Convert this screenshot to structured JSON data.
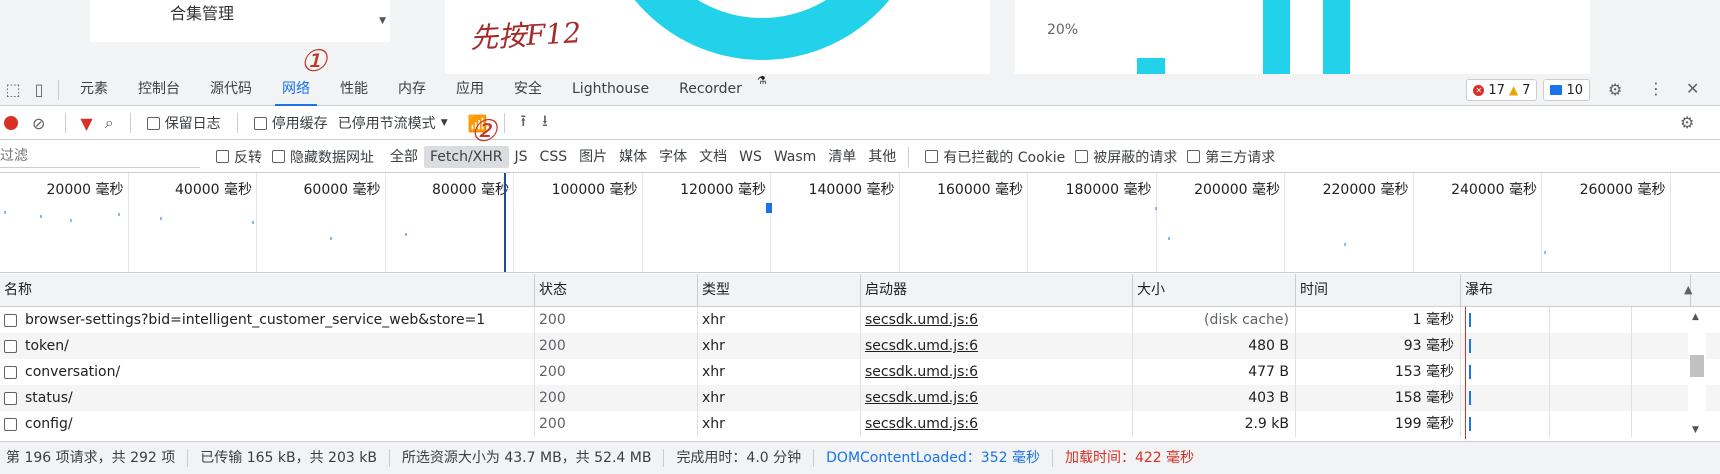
{
  "background_page": {
    "select_value": "合集管理",
    "handwritten_note": "先按F12",
    "axis_label": "20%"
  },
  "devtools": {
    "tabs": [
      {
        "label": "元素"
      },
      {
        "label": "控制台"
      },
      {
        "label": "源代码"
      },
      {
        "label": "网络",
        "active": true
      },
      {
        "label": "性能"
      },
      {
        "label": "内存"
      },
      {
        "label": "应用"
      },
      {
        "label": "安全"
      },
      {
        "label": "Lighthouse"
      },
      {
        "label": "Recorder"
      }
    ],
    "badges": {
      "errors": "17",
      "warnings": "7",
      "messages": "10"
    },
    "toolbar": {
      "preserve_log": "保留日志",
      "disable_cache": "停用缓存",
      "throttling": "已停用节流模式"
    },
    "filter": {
      "placeholder": "过滤",
      "invert": "反转",
      "hide_data_urls": "隐藏数据网址",
      "types": [
        "全部",
        "Fetch/XHR",
        "JS",
        "CSS",
        "图片",
        "媒体",
        "字体",
        "文档",
        "WS",
        "Wasm",
        "清单",
        "其他"
      ],
      "selected_type": "Fetch/XHR",
      "blocked_cookies": "有已拦截的 Cookie",
      "blocked_requests": "被屏蔽的请求",
      "third_party": "第三方请求"
    },
    "overview_ticks": [
      "20000 毫秒",
      "40000 毫秒",
      "60000 毫秒",
      "80000 毫秒",
      "100000 毫秒",
      "120000 毫秒",
      "140000 毫秒",
      "160000 毫秒",
      "180000 毫秒",
      "200000 毫秒",
      "220000 毫秒",
      "240000 毫秒",
      "260000 毫秒"
    ],
    "table": {
      "columns": [
        "名称",
        "状态",
        "类型",
        "启动器",
        "大小",
        "时间",
        "瀑布"
      ],
      "rows": [
        {
          "name": "browser-settings?bid=intelligent_customer_service_web&store=1",
          "status": "200",
          "type": "xhr",
          "initiator": "secsdk.umd.js:6",
          "size": "(disk cache)",
          "time": "1 毫秒"
        },
        {
          "name": "token/",
          "status": "200",
          "type": "xhr",
          "initiator": "secsdk.umd.js:6",
          "size": "480 B",
          "time": "93 毫秒"
        },
        {
          "name": "conversation/",
          "status": "200",
          "type": "xhr",
          "initiator": "secsdk.umd.js:6",
          "size": "477 B",
          "time": "153 毫秒"
        },
        {
          "name": "status/",
          "status": "200",
          "type": "xhr",
          "initiator": "secsdk.umd.js:6",
          "size": "403 B",
          "time": "158 毫秒"
        },
        {
          "name": "config/",
          "status": "200",
          "type": "xhr",
          "initiator": "secsdk.umd.js:6",
          "size": "2.9 kB",
          "time": "199 毫秒"
        }
      ]
    },
    "status_bar": {
      "requests": "第 196 项请求，共 292 项",
      "transferred": "已传输 165 kB，共 203 kB",
      "resources": "所选资源大小为 43.7 MB，共 52.4 MB",
      "finish": "完成用时：4.0 分钟",
      "dom_content_loaded": "DOMContentLoaded：352 毫秒",
      "load": "加载时间：422 毫秒"
    },
    "annotations": [
      "①",
      "②"
    ]
  }
}
